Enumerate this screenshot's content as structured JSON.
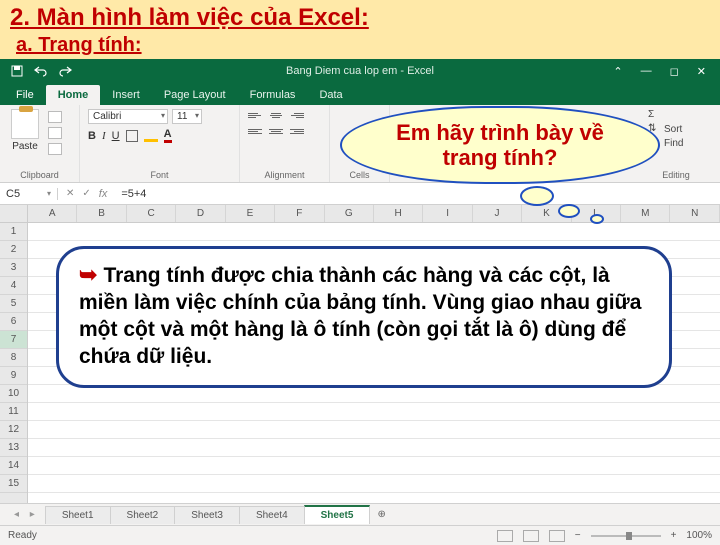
{
  "slide": {
    "heading": "2. Màn hình làm việc của Excel:",
    "subheading": "a. Trang tính:"
  },
  "excel": {
    "title": "Bang Diem cua lop em - Excel",
    "qat": {
      "save": "save-icon",
      "undo": "undo-icon",
      "redo": "redo-icon"
    },
    "tabs": [
      "File",
      "Home",
      "Insert",
      "Page Layout",
      "Formulas",
      "Data"
    ],
    "active_tab": "Home",
    "ribbon": {
      "clipboard_label": "Clipboard",
      "paste_label": "Paste",
      "font_label": "Font",
      "font_name": "Calibri",
      "font_size": "11",
      "alignment_label": "Alignment",
      "cells_label": "Cells",
      "editing_label": "Editing",
      "editing_items": {
        "sort": "Sort",
        "find": "Find"
      }
    },
    "namebox": "C5",
    "formula": "=5+4",
    "columns": [
      "A",
      "B",
      "C",
      "D",
      "E",
      "F",
      "G",
      "H",
      "I",
      "J",
      "K",
      "L",
      "M",
      "N"
    ],
    "rows": [
      "1",
      "2",
      "3",
      "4",
      "5",
      "6",
      "7",
      "8",
      "9",
      "10",
      "11",
      "12",
      "13",
      "14",
      "15"
    ],
    "sheets": [
      "Sheet1",
      "Sheet2",
      "Sheet3",
      "Sheet4",
      "Sheet5"
    ],
    "active_sheet": "Sheet5",
    "status": "Ready",
    "zoom": "100%"
  },
  "bubble": {
    "question": "Em hãy trình bày về trang tính?",
    "answer": "Trang tính được chia thành các hàng và các cột, là miền làm việc chính của bảng tính. Vùng giao nhau giữa một cột và một hàng là ô tính (còn gọi tắt là ô) dùng để chứa dữ liệu."
  }
}
